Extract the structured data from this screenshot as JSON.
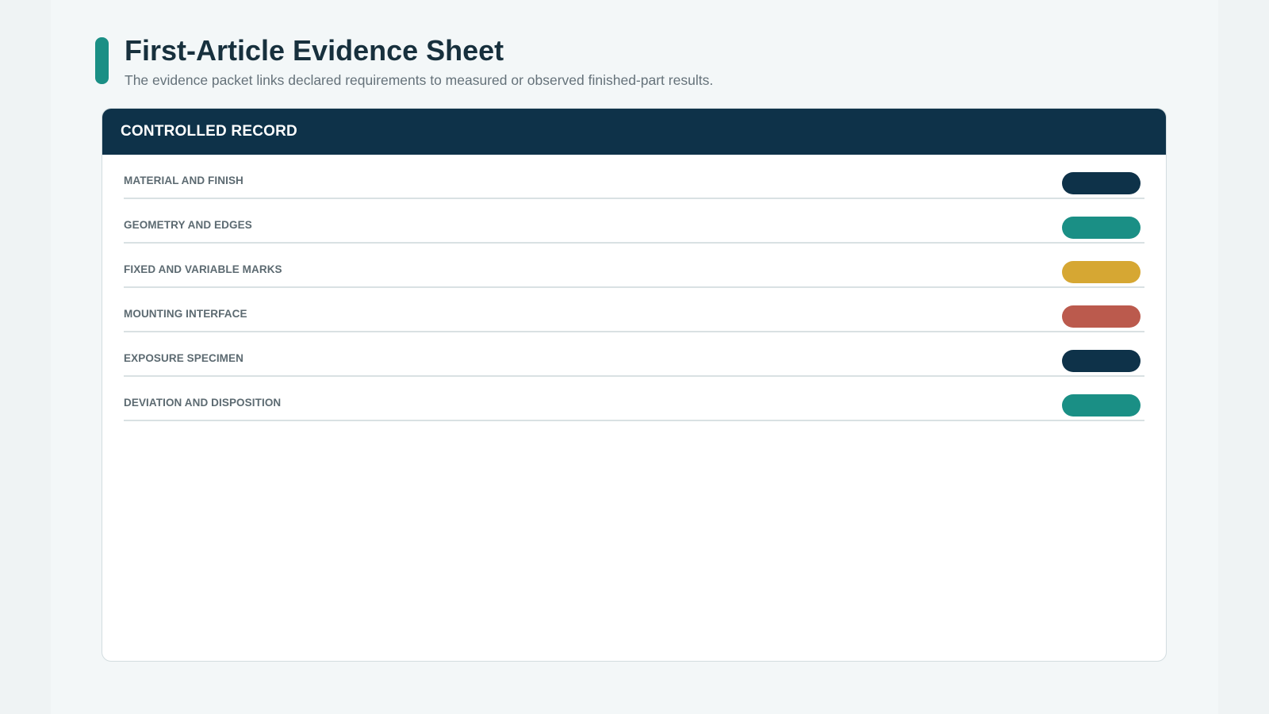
{
  "header": {
    "title": "First-Article Evidence Sheet",
    "subtitle": "The evidence packet links declared requirements to measured or observed finished-part results."
  },
  "record": {
    "heading": "CONTROLLED RECORD",
    "rows": [
      {
        "label": "MATERIAL AND FINISH",
        "status_color": "#0e3249"
      },
      {
        "label": "GEOMETRY AND EDGES",
        "status_color": "#1a8f85"
      },
      {
        "label": "FIXED AND VARIABLE MARKS",
        "status_color": "#d6a733"
      },
      {
        "label": "MOUNTING INTERFACE",
        "status_color": "#bb5a4d"
      },
      {
        "label": "EXPOSURE SPECIMEN",
        "status_color": "#0e3249"
      },
      {
        "label": "DEVIATION AND DISPOSITION",
        "status_color": "#1a8f85"
      }
    ]
  },
  "colors": {
    "accent": "#1a8f85",
    "header_bg": "#0e3249"
  }
}
